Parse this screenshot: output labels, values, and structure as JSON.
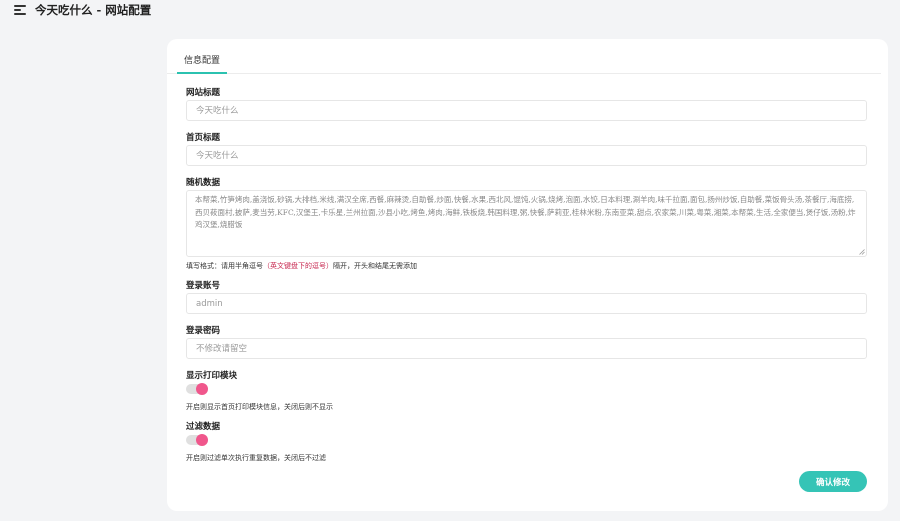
{
  "header": {
    "title": "今天吃什么 - 网站配置"
  },
  "tabs": [
    {
      "label": "信息配置",
      "active": true
    }
  ],
  "form": {
    "site_title": {
      "label": "网站标题",
      "placeholder": "今天吃什么"
    },
    "home_title": {
      "label": "首页标题",
      "placeholder": "今天吃什么"
    },
    "random_data": {
      "label": "随机数据",
      "value": "本帮菜,竹笋烤肉,盖浇饭,砂锅,大排档,米线,满汉全席,西餐,麻辣烫,自助餐,炒面,快餐,水果,西北风,馄饨,火锅,烧烤,泡面,水饺,日本料理,涮羊肉,味千拉面,面包,扬州炒饭,自助餐,菜饭骨头汤,茶餐厅,海底捞,西贝莜面村,披萨,麦当劳,KFC,汉堡王,卡乐星,兰州拉面,沙县小吃,烤鱼,烤肉,海鲜,铁板烧,韩国料理,粥,快餐,萨莉亚,桂林米粉,东南亚菜,甜点,农家菜,川菜,粤菜,湘菜,本帮菜,生活,全家便当,煲仔饭,汤粉,炸鸡汉堡,烧腊饭",
      "hint_prefix": "填写格式：请用半角逗号",
      "hint_highlight": "（英文键盘下的逗号）",
      "hint_suffix": "隔开，开头和结尾无需添加"
    },
    "login_account": {
      "label": "登录账号",
      "placeholder": "admin"
    },
    "login_password": {
      "label": "登录密码",
      "placeholder": "不修改请留空"
    },
    "show_print": {
      "label": "显示打印模块",
      "enabled": true,
      "hint": "开启则显示首页打印模块信息，关闭后则不显示"
    },
    "filter_data": {
      "label": "过滤数据",
      "enabled": true,
      "hint": "开启则过滤单次执行重复数据，关闭后不过滤"
    },
    "submit_label": "确认修改"
  },
  "colors": {
    "accent": "#2bc2b0",
    "button": "#35c4b6",
    "switch_on": "#f0578c",
    "warning_text": "#c7254e"
  },
  "icons": {
    "menu": "hamburger-menu-icon"
  }
}
